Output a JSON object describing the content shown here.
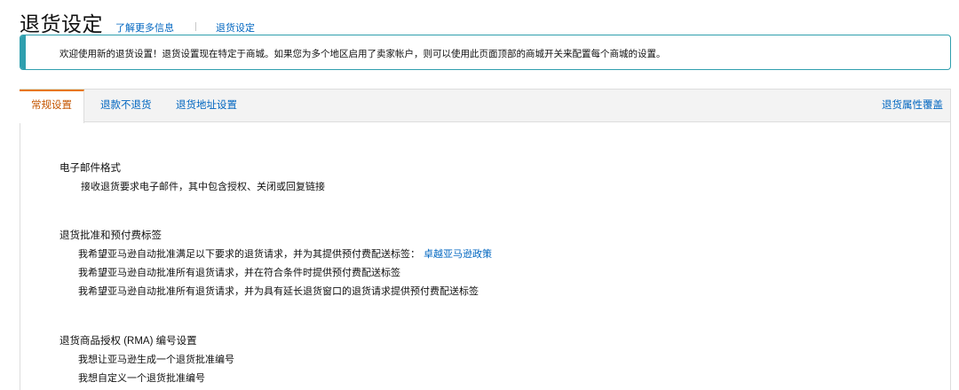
{
  "header": {
    "title": "退货设定",
    "learn_more": "了解更多信息",
    "settings_link": "退货设定"
  },
  "banner": {
    "text": "欢迎使用新的退货设置！退货设置现在特定于商城。如果您为多个地区启用了卖家帐户，则可以使用此页面顶部的商城开关来配置每个商城的设置。"
  },
  "tabs": {
    "general": "常规设置",
    "returnless_refund": "退款不退货",
    "return_address": "退货地址设置",
    "override": "退货属性覆盖"
  },
  "email_section": {
    "title": "电子邮件格式",
    "item": "接收退货要求电子邮件，其中包含授权、关闭或回复链接"
  },
  "approval_section": {
    "title": "退货批准和预付费标签",
    "items": [
      "我希望亚马逊自动批准满足以下要求的退货请求，并为其提供预付费配送标签：",
      "我希望亚马逊自动批准所有退货请求，并在符合条件时提供预付费配送标签",
      "我希望亚马逊自动批准所有退货请求，并为具有延长退货窗口的退货请求提供预付费配送标签"
    ],
    "policy_link": "卓越亚马逊政策"
  },
  "rma_section": {
    "title": "退货商品授权 (RMA) 编号设置",
    "items": [
      "我想让亚马逊生成一个退货批准编号",
      "我想自定义一个退货批准编号"
    ]
  },
  "colors": {
    "link": "#0066c0",
    "active_tab": "#c45500",
    "active_tab_border": "#e77600",
    "banner_accent": "#2f9fae"
  }
}
